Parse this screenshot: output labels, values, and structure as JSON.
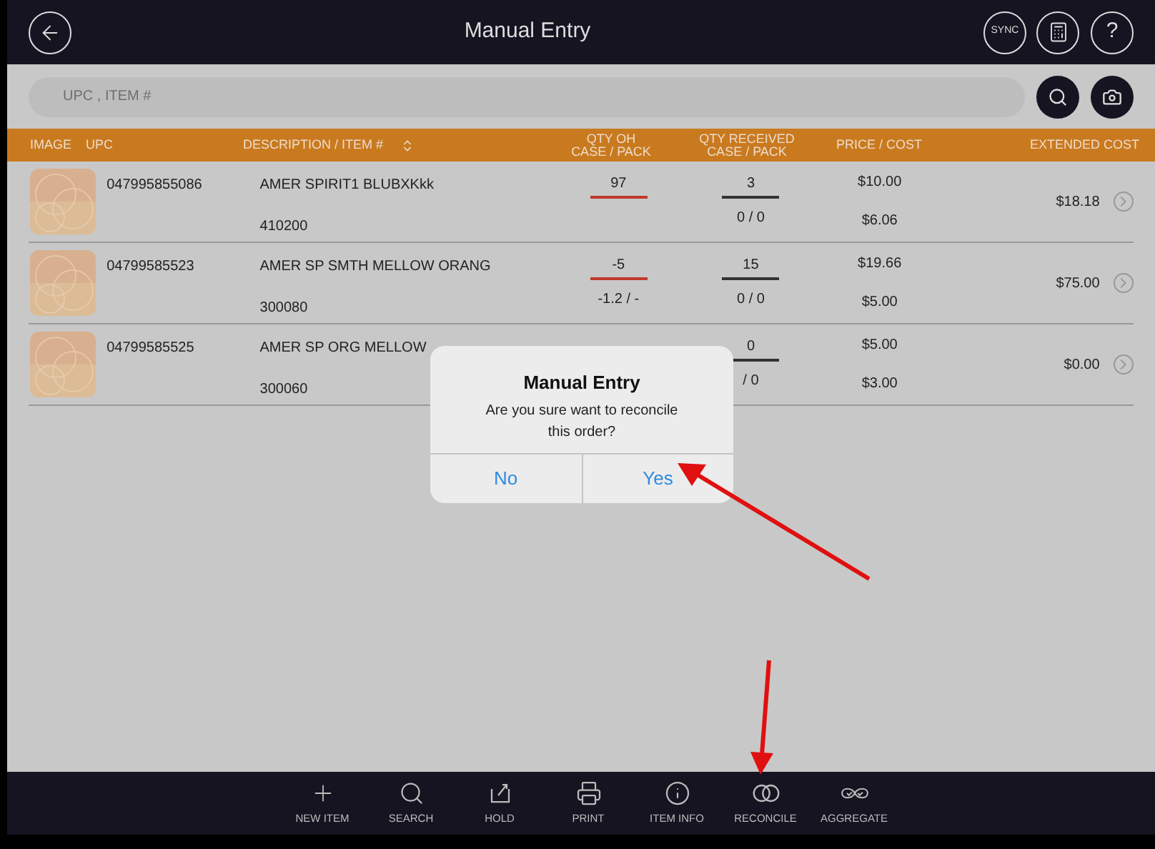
{
  "header": {
    "title": "Manual Entry",
    "sync_label": "SYNC",
    "help_label": "?"
  },
  "search": {
    "placeholder": "UPC , ITEM #"
  },
  "table": {
    "columns": [
      {
        "label": "IMAGE",
        "kind": "plain"
      },
      {
        "label": "UPC",
        "kind": "plain"
      },
      {
        "label": "DESCRIPTION / ITEM #",
        "kind": "sortable"
      },
      {
        "label": "QTY OH\nCASE / PACK",
        "kind": "plain"
      },
      {
        "label": "QTY RECEIVED\nCASE / PACK",
        "kind": "plain"
      },
      {
        "label": "PRICE / COST",
        "kind": "plain"
      },
      {
        "label": "EXTENDED COST",
        "kind": "plain"
      }
    ],
    "rows": [
      {
        "upc": "047995855086",
        "description": "AMER SPIRIT1 BLUBXKkk",
        "item": "410200",
        "qty_oh": "97",
        "qty_oh_sub": "",
        "qty_received": "3",
        "qty_received_sub": "0 / 0",
        "price": "$10.00",
        "cost": "$6.06",
        "extended": "$18.18"
      },
      {
        "upc": "04799585523",
        "description": "AMER SP SMTH MELLOW ORANG",
        "item": "300080",
        "qty_oh": "-5",
        "qty_oh_sub": "-1.2 / -",
        "qty_received": "15",
        "qty_received_sub": "0 / 0",
        "price": "$19.66",
        "cost": "$5.00",
        "extended": "$75.00"
      },
      {
        "upc": "04799585525",
        "description": "AMER SP ORG MELLOW",
        "item": "300060",
        "qty_oh": "",
        "qty_oh_sub": "",
        "qty_received": "0",
        "qty_received_sub": "/ 0",
        "price": "$5.00",
        "cost": "$3.00",
        "extended": "$0.00"
      }
    ]
  },
  "dialog": {
    "title": "Manual Entry",
    "message": "Are you sure want to reconcile this order?",
    "buttons": [
      "No",
      "Yes"
    ]
  },
  "toolbar": [
    {
      "label": "NEW ITEM",
      "kind": "plus"
    },
    {
      "label": "SEARCH",
      "kind": "search"
    },
    {
      "label": "HOLD",
      "kind": "hold"
    },
    {
      "label": "PRINT",
      "kind": "print"
    },
    {
      "label": "ITEM INFO",
      "kind": "info"
    },
    {
      "label": "RECONCILE",
      "kind": "rings"
    },
    {
      "label": "AGGREGATE",
      "kind": "aggregate"
    }
  ]
}
